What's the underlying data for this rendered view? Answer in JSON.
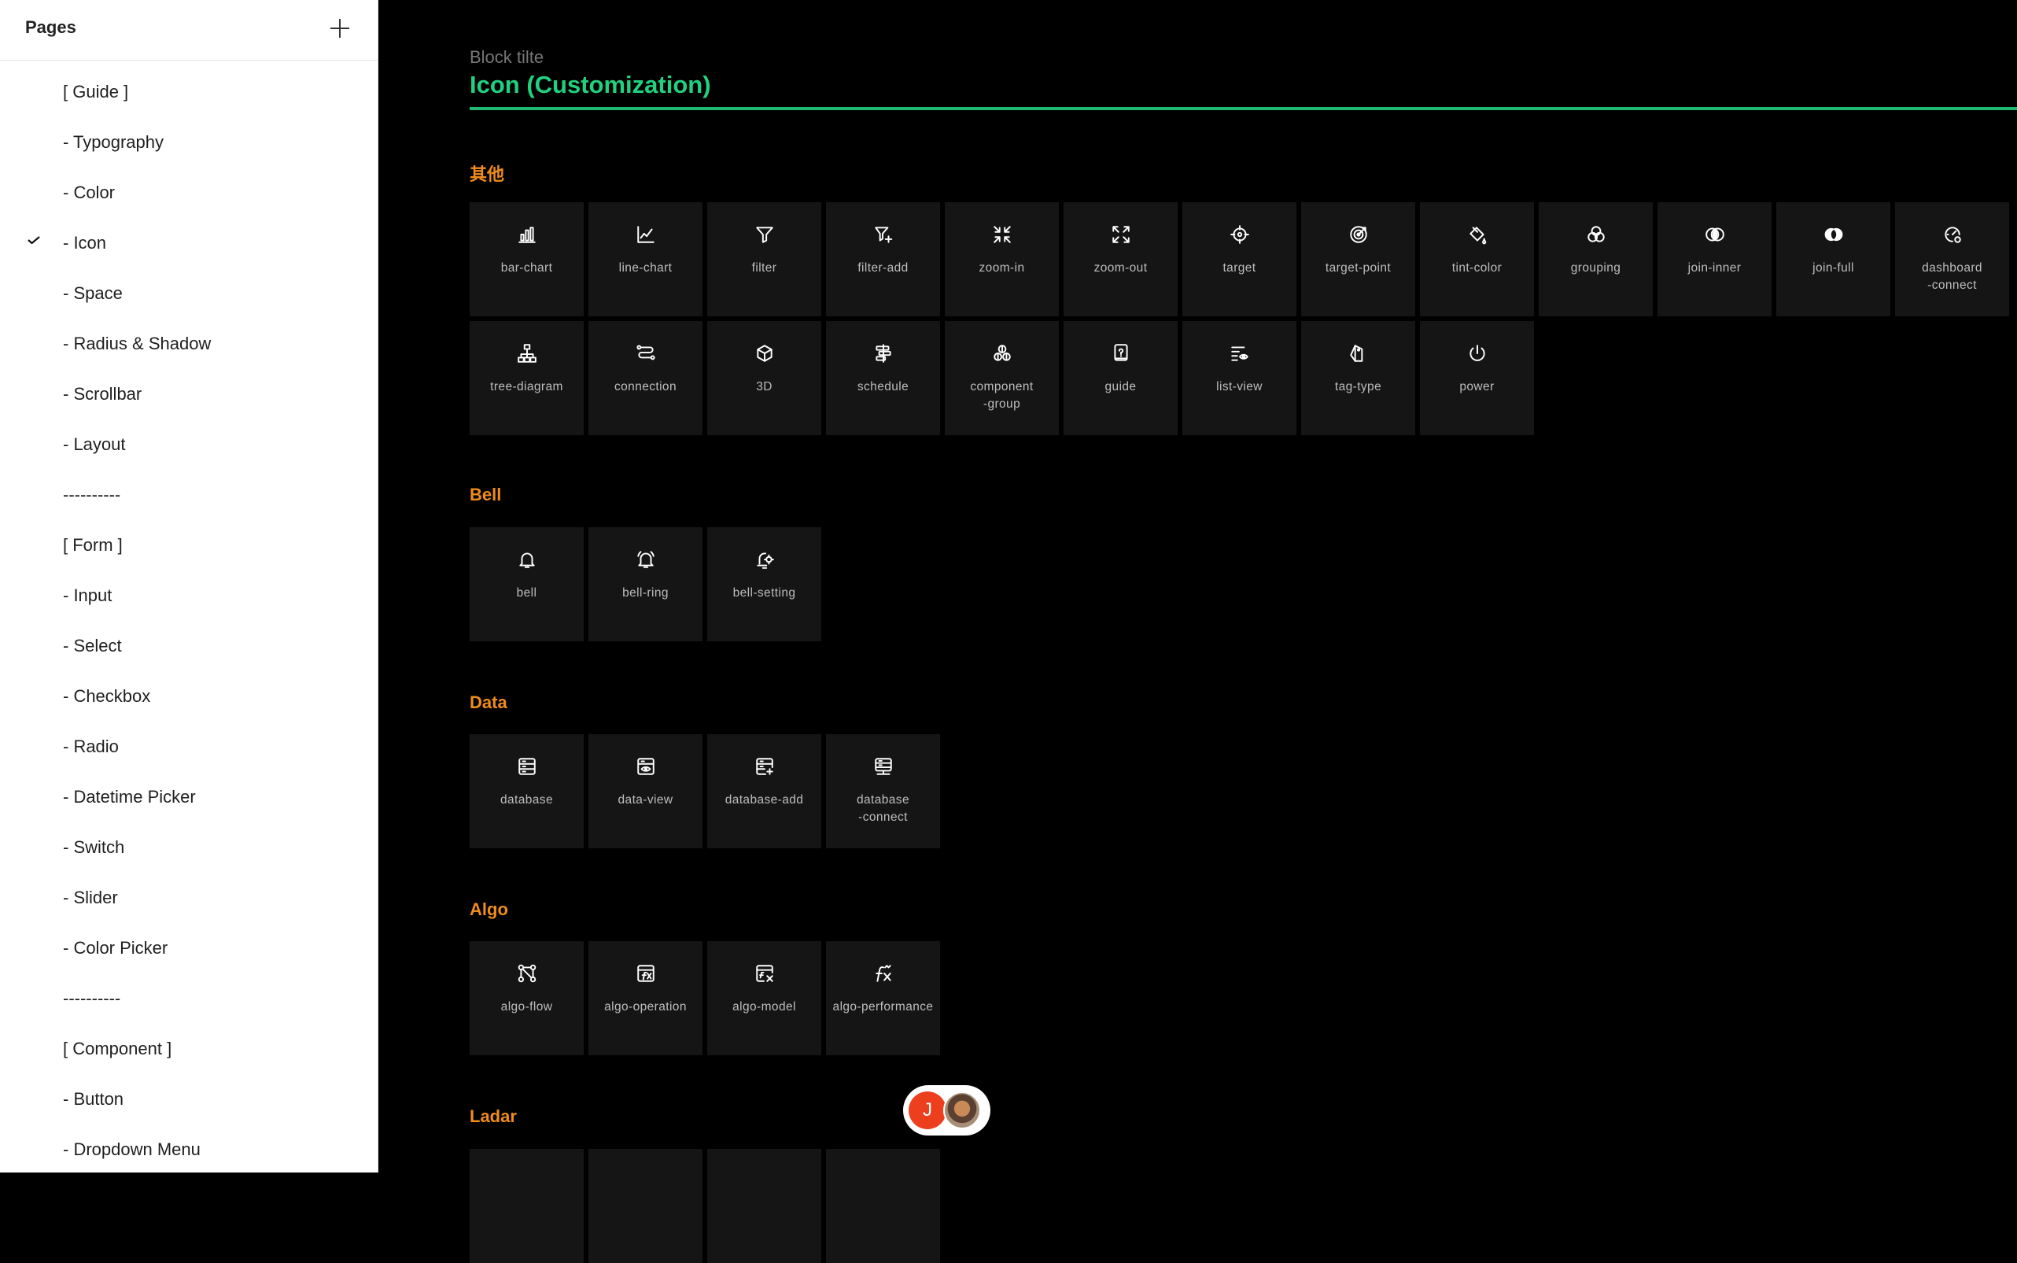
{
  "sidebar": {
    "title": "Pages",
    "items": [
      {
        "label": "[ Guide ]",
        "checked": false
      },
      {
        "label": "- Typography",
        "checked": false
      },
      {
        "label": "- Color",
        "checked": false
      },
      {
        "label": "- Icon",
        "checked": true
      },
      {
        "label": "- Space",
        "checked": false
      },
      {
        "label": "- Radius & Shadow",
        "checked": false
      },
      {
        "label": "- Scrollbar",
        "checked": false
      },
      {
        "label": "- Layout",
        "checked": false
      },
      {
        "label": "----------",
        "checked": false
      },
      {
        "label": "[ Form ]",
        "checked": false
      },
      {
        "label": "- Input",
        "checked": false
      },
      {
        "label": "- Select",
        "checked": false
      },
      {
        "label": "- Checkbox",
        "checked": false
      },
      {
        "label": "- Radio",
        "checked": false
      },
      {
        "label": "- Datetime Picker",
        "checked": false
      },
      {
        "label": "- Switch",
        "checked": false
      },
      {
        "label": "- Slider",
        "checked": false
      },
      {
        "label": "- Color Picker",
        "checked": false
      },
      {
        "label": "----------",
        "checked": false
      },
      {
        "label": "[ Component ]",
        "checked": false
      },
      {
        "label": "- Button",
        "checked": false
      },
      {
        "label": "- Dropdown Menu",
        "checked": false
      }
    ]
  },
  "block": {
    "subtitle": "Block tilte",
    "title": "Icon (Customization)",
    "accent_color": "#21d17f"
  },
  "sections": [
    {
      "title": "其他",
      "icons": [
        {
          "label": "bar-chart",
          "icon": "bar-chart-icon"
        },
        {
          "label": "line-chart",
          "icon": "line-chart-icon"
        },
        {
          "label": "filter",
          "icon": "filter-icon"
        },
        {
          "label": "filter-add",
          "icon": "filter-add-icon"
        },
        {
          "label": "zoom-in",
          "icon": "zoom-in-icon"
        },
        {
          "label": "zoom-out",
          "icon": "zoom-out-icon"
        },
        {
          "label": "target",
          "icon": "target-icon"
        },
        {
          "label": "target-point",
          "icon": "target-point-icon"
        },
        {
          "label": "tint-color",
          "icon": "tint-color-icon"
        },
        {
          "label": "grouping",
          "icon": "grouping-icon"
        },
        {
          "label": "join-inner",
          "icon": "join-inner-icon"
        },
        {
          "label": "join-full",
          "icon": "join-full-icon"
        },
        {
          "label": "dashboard\n-connect",
          "icon": "dashboard-connect-icon"
        },
        {
          "label": "tree-diagram",
          "icon": "tree-diagram-icon"
        },
        {
          "label": "connection",
          "icon": "connection-icon"
        },
        {
          "label": "3D",
          "icon": "3d-icon"
        },
        {
          "label": "schedule",
          "icon": "schedule-icon"
        },
        {
          "label": "component\n-group",
          "icon": "component-group-icon"
        },
        {
          "label": "guide",
          "icon": "guide-icon"
        },
        {
          "label": "list-view",
          "icon": "list-view-icon"
        },
        {
          "label": "tag-type",
          "icon": "tag-type-icon"
        },
        {
          "label": "power",
          "icon": "power-icon"
        }
      ]
    },
    {
      "title": "Bell",
      "icons": [
        {
          "label": "bell",
          "icon": "bell-icon"
        },
        {
          "label": "bell-ring",
          "icon": "bell-ring-icon"
        },
        {
          "label": "bell-setting",
          "icon": "bell-setting-icon"
        }
      ]
    },
    {
      "title": "Data",
      "icons": [
        {
          "label": "database",
          "icon": "database-icon"
        },
        {
          "label": "data-view",
          "icon": "data-view-icon"
        },
        {
          "label": "database-add",
          "icon": "database-add-icon"
        },
        {
          "label": "database\n-connect",
          "icon": "database-connect-icon"
        }
      ]
    },
    {
      "title": "Algo",
      "icons": [
        {
          "label": "algo-flow",
          "icon": "algo-flow-icon"
        },
        {
          "label": "algo-operation",
          "icon": "algo-operation-icon"
        },
        {
          "label": "algo-model",
          "icon": "algo-model-icon"
        },
        {
          "label": "algo-performance",
          "icon": "algo-performance-icon"
        }
      ]
    },
    {
      "title": "Ladar",
      "icons": []
    }
  ],
  "collaborators": [
    {
      "initial": "J",
      "color": "#ed3f1e"
    },
    {
      "initial": "",
      "color": "#8a6a50"
    }
  ],
  "colors": {
    "section_title": "#f08c1c",
    "cell_bg": "#151515",
    "page_bg": "#000000"
  }
}
